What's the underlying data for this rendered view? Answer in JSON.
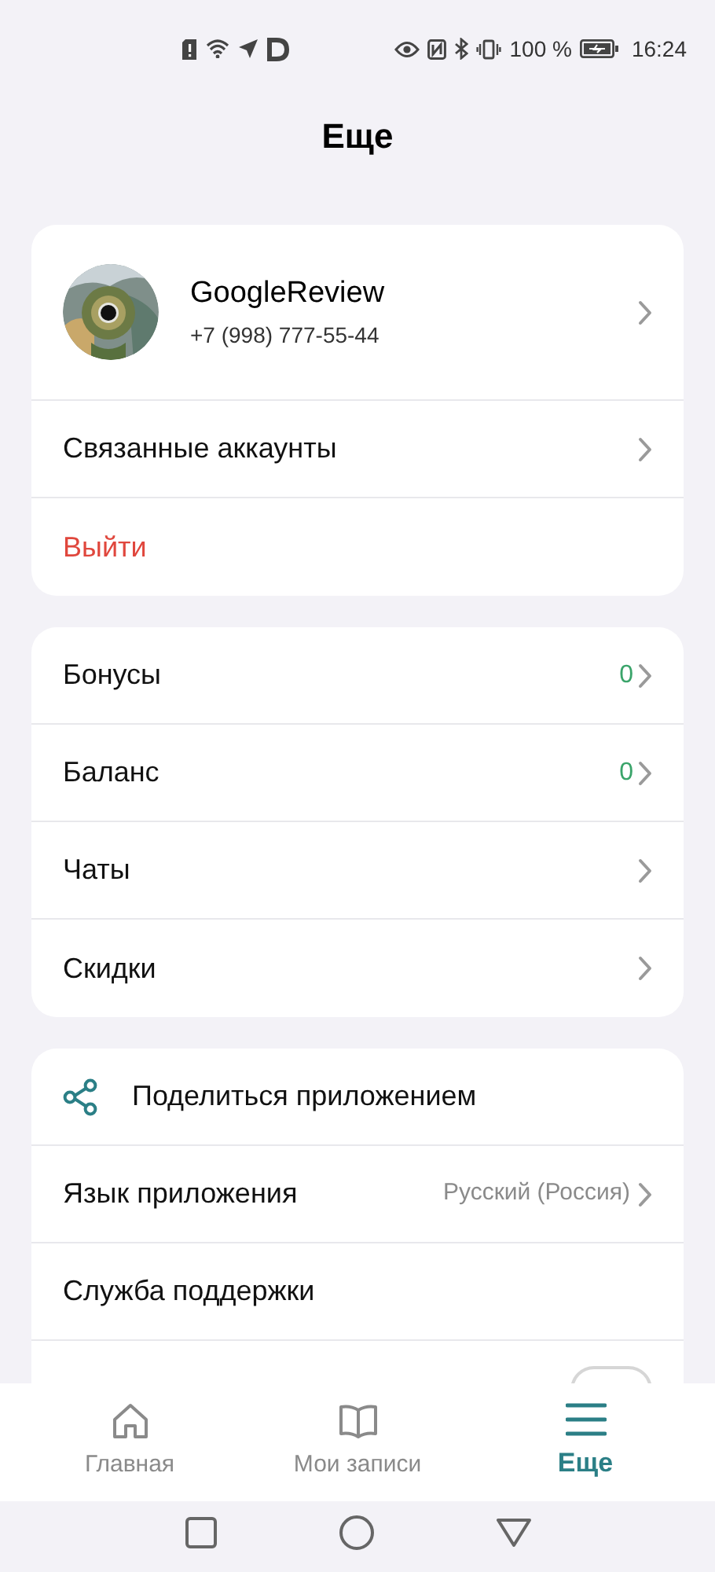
{
  "status_bar": {
    "battery": "100 %",
    "time": "16:24"
  },
  "title": "Еще",
  "profile": {
    "name": "GoogleReview",
    "phone": "+7 (998) 777-55-44"
  },
  "sections": [
    {
      "items": [
        {
          "kind": "nav",
          "label": "Связанные аккаунты"
        },
        {
          "kind": "danger",
          "label": "Выйти"
        }
      ]
    },
    {
      "items": [
        {
          "kind": "count",
          "label": "Бонусы",
          "value": "0"
        },
        {
          "kind": "count",
          "label": "Баланс",
          "value": "0"
        },
        {
          "kind": "nav",
          "label": "Чаты"
        },
        {
          "kind": "nav",
          "label": "Скидки"
        }
      ]
    },
    {
      "items": [
        {
          "kind": "share",
          "label": "Поделиться приложением"
        },
        {
          "kind": "option",
          "label": "Язык приложения",
          "value": "Русский (Россия)"
        },
        {
          "kind": "plain",
          "label": "Служба поддержки"
        },
        {
          "kind": "toggle",
          "on": false
        }
      ]
    }
  ],
  "tabs": [
    {
      "label": "Главная",
      "selected": false
    },
    {
      "label": "Мои записи",
      "selected": false
    },
    {
      "label": "Еще",
      "selected": true
    }
  ]
}
